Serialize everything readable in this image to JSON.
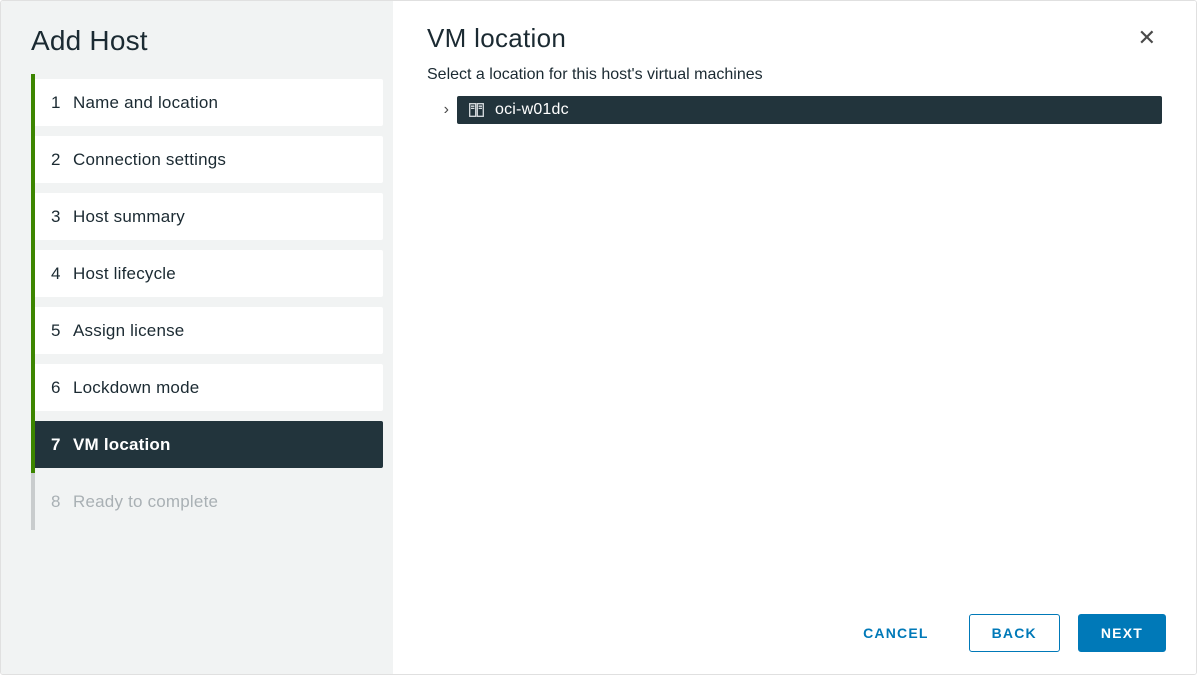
{
  "wizard": {
    "title": "Add Host",
    "steps": [
      {
        "num": "1",
        "label": "Name and location"
      },
      {
        "num": "2",
        "label": "Connection settings"
      },
      {
        "num": "3",
        "label": "Host summary"
      },
      {
        "num": "4",
        "label": "Host lifecycle"
      },
      {
        "num": "5",
        "label": "Assign license"
      },
      {
        "num": "6",
        "label": "Lockdown mode"
      },
      {
        "num": "7",
        "label": "VM location"
      },
      {
        "num": "8",
        "label": "Ready to complete"
      }
    ],
    "active_index": 6,
    "disabled_indices": [
      7
    ]
  },
  "panel": {
    "title": "VM location",
    "subtitle": "Select a location for this host's virtual machines",
    "tree": {
      "chevron": "›",
      "node_label": "oci-w01dc"
    },
    "buttons": {
      "cancel": "CANCEL",
      "back": "BACK",
      "next": "NEXT"
    },
    "close_glyph": "✕"
  }
}
